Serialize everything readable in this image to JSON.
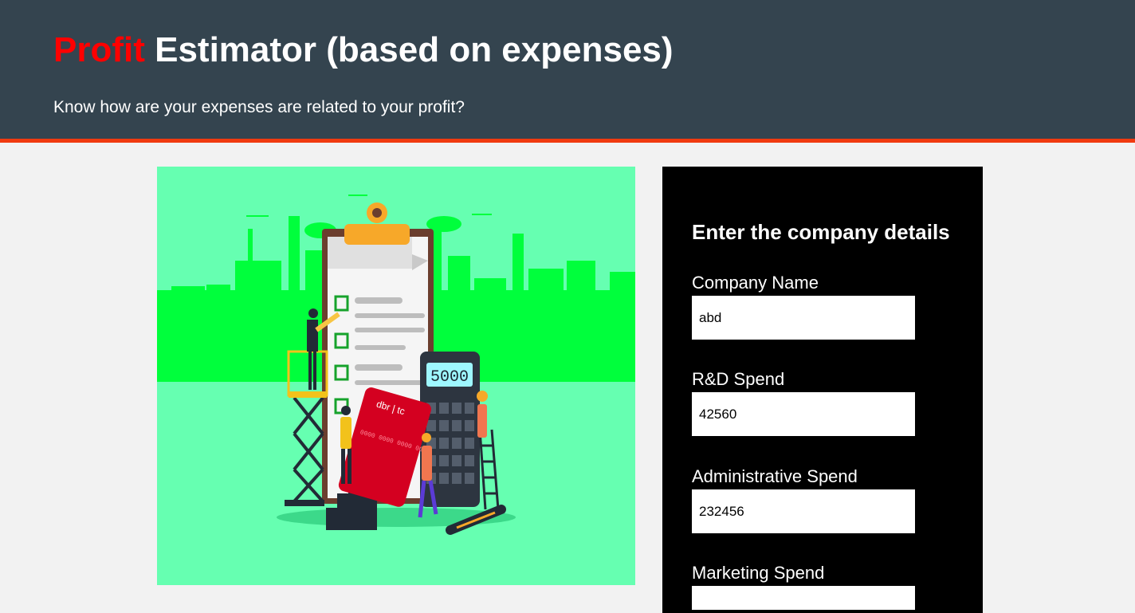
{
  "header": {
    "title_accent": "Profit",
    "title_rest": " Estimator (based on expenses)",
    "subtitle": "Know how are your expenses are related to your profit?"
  },
  "illustration": {
    "calculator_display": "5000",
    "card_brand": "dbr | tc",
    "card_number": "0000 0000 0000 0000"
  },
  "form": {
    "heading": "Enter the company details",
    "fields": [
      {
        "label": "Company Name",
        "value": "abd"
      },
      {
        "label": "R&D Spend",
        "value": "42560"
      },
      {
        "label": "Administrative Spend",
        "value": "232456"
      },
      {
        "label": "Marketing Spend",
        "value": ""
      }
    ]
  },
  "colors": {
    "header_bg": "#34444f",
    "accent_red": "#ff0000",
    "header_border": "#f03a10",
    "illustration_bg": "#66ffb1",
    "city_green": "#00ff3c",
    "panel_bg": "#000000"
  }
}
